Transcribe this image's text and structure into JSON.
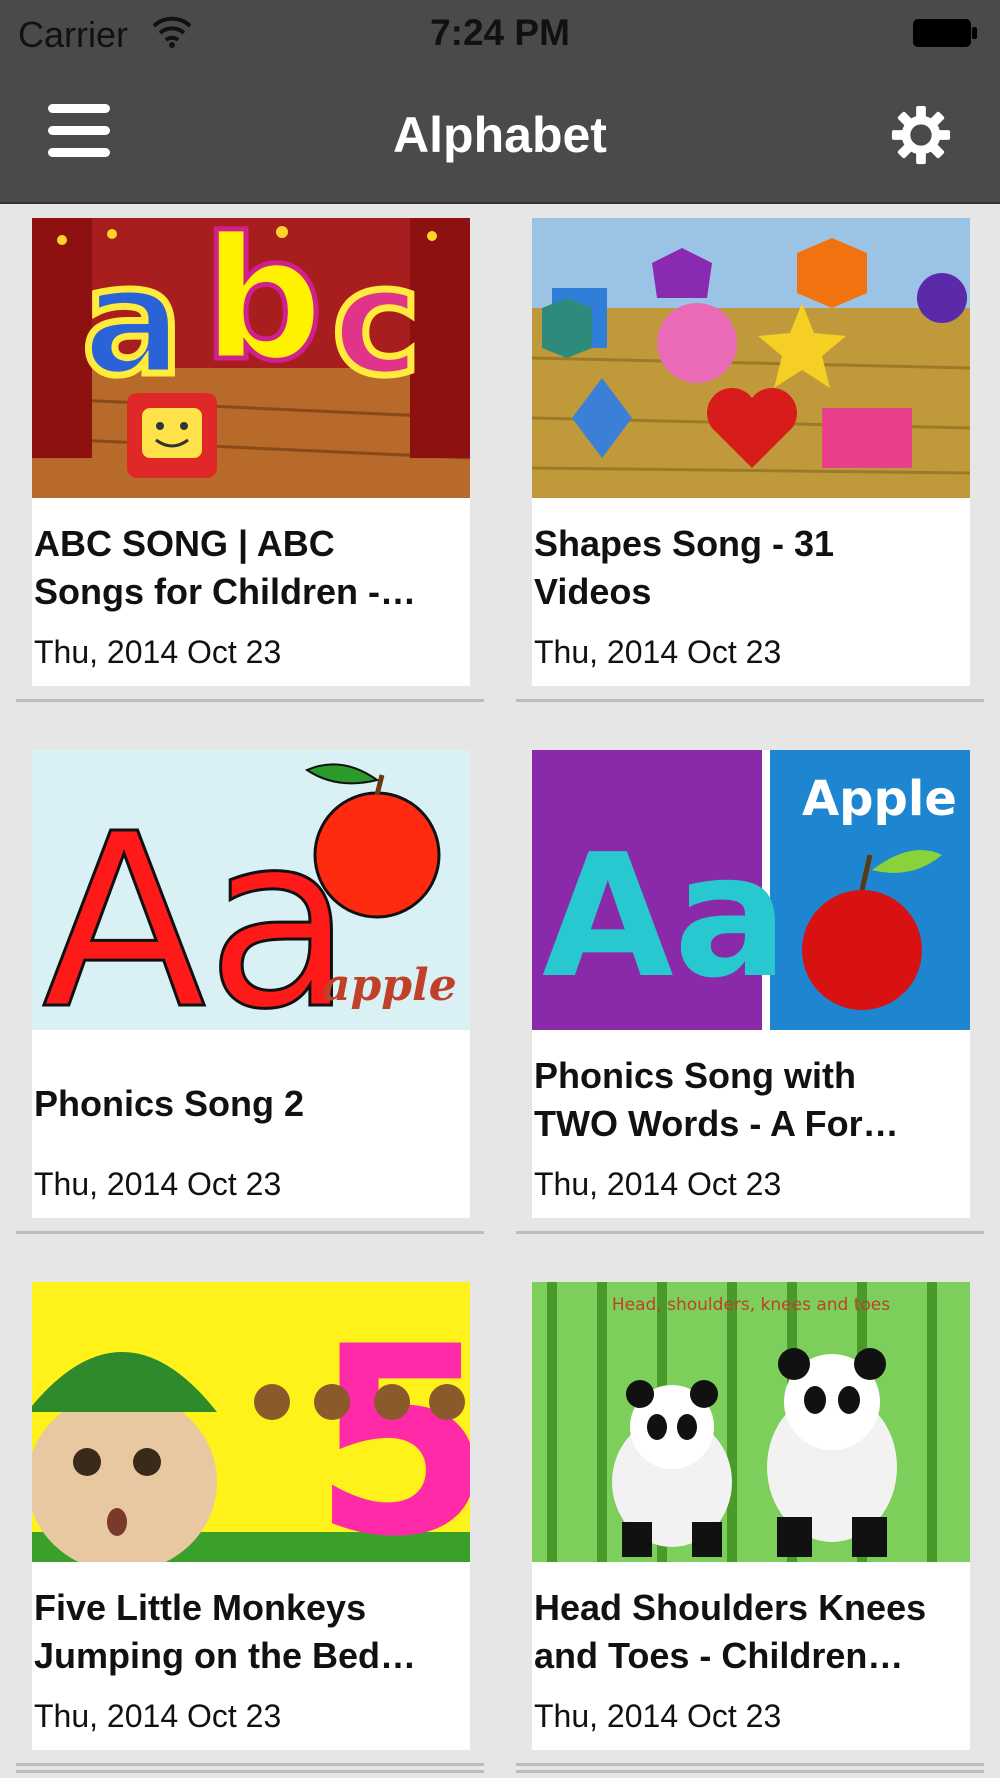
{
  "status_bar": {
    "carrier": "Carrier",
    "time": "7:24 PM"
  },
  "nav": {
    "title": "Alphabet",
    "menu_icon": "hamburger-menu-icon",
    "settings_icon": "gear-icon"
  },
  "videos": [
    {
      "title_line1": "ABC SONG | ABC",
      "title_line2": "Songs for Children -…",
      "date": "Thu, 2014 Oct 23"
    },
    {
      "title_line1": "Shapes Song - 31",
      "title_line2": "Videos",
      "date": "Thu, 2014 Oct 23"
    },
    {
      "title_line1": "Phonics Song 2",
      "title_line2": "",
      "date": "Thu, 2014 Oct 23"
    },
    {
      "title_line1": "Phonics Song with",
      "title_line2": "TWO Words - A For…",
      "date": "Thu, 2014 Oct 23",
      "thumb_word": "Apple"
    },
    {
      "title_line1": "Five Little Monkeys",
      "title_line2": "Jumping on the Bed…",
      "date": "Thu, 2014 Oct 23"
    },
    {
      "title_line1": "Head Shoulders Knees",
      "title_line2": "and Toes - Children…",
      "date": "Thu, 2014 Oct 23",
      "thumb_caption": "Head, shoulders, knees and toes"
    }
  ],
  "thumb_text": {
    "abc_a": "a",
    "abc_b": "b",
    "abc_c": "c",
    "phonics2_big": "Aa",
    "phonics2_word": "apple",
    "phonics_two_big": "Aa",
    "monkeys_number": "5"
  },
  "colors": {
    "bar_bg": "#4a4a4a",
    "page_bg": "#e6e6e6",
    "card_bg": "#ffffff"
  }
}
